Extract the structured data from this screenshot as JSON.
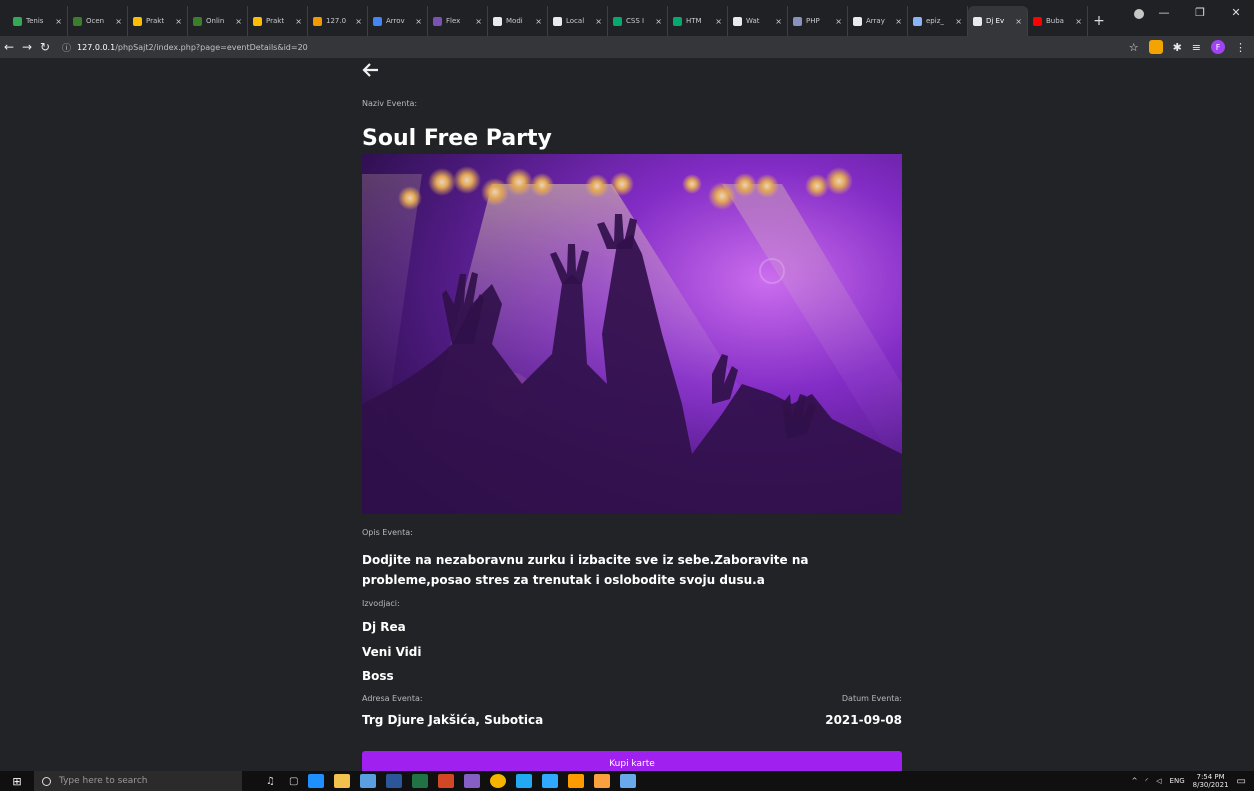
{
  "browser": {
    "tabs": [
      {
        "label": "Tenis",
        "color": "#34a853"
      },
      {
        "label": "Ocen",
        "color": "#3a7d2b"
      },
      {
        "label": "Prakt",
        "color": "#fbbc04"
      },
      {
        "label": "Onlin",
        "color": "#3a7d2b"
      },
      {
        "label": "Prakt",
        "color": "#fbbc04"
      },
      {
        "label": "127.0",
        "color": "#f29900"
      },
      {
        "label": "Arrov",
        "color": "#4285f4"
      },
      {
        "label": "Flex",
        "color": "#7952b3"
      },
      {
        "label": "Modi",
        "color": "#e8eaed"
      },
      {
        "label": "Local",
        "color": "#e8eaed"
      },
      {
        "label": "CSS I",
        "color": "#04aa6d"
      },
      {
        "label": "HTM",
        "color": "#04aa6d"
      },
      {
        "label": "Wat",
        "color": "#e8eaed"
      },
      {
        "label": "PHP",
        "color": "#8892bf"
      },
      {
        "label": "Array",
        "color": "#e8eaed"
      },
      {
        "label": "epiz_",
        "color": "#8ab4f8"
      },
      {
        "label": "Dj Ev",
        "color": "#e8eaed",
        "active": true
      },
      {
        "label": "Buba",
        "color": "#ff0000"
      }
    ],
    "tab_close": "×",
    "new_tab": "+",
    "url_host": "127.0.0.1",
    "url_path": "/phpSajt2/index.php?page=eventDetails&id=20",
    "profile_initial": "F"
  },
  "event": {
    "back_icon": "arrow-left-icon",
    "name_label": "Naziv Eventa:",
    "name": "Soul Free Party",
    "desc_label": "Opis Eventa:",
    "description": "Dodjite na nezaboravnu zurku i izbacite sve iz sebe.Zaboravite na probleme,posao stres za trenutak i oslobodite svoju dusu.a",
    "performers_label": "Izvodjaci:",
    "performers": [
      "Dj Rea",
      "Veni Vidi",
      "Boss"
    ],
    "address_label": "Adresa Eventa:",
    "address": "Trg Djure Jakšića, Subotica",
    "date_label": "Datum Eventa:",
    "date": "2021-09-08",
    "buy_label": "Kupi karte"
  },
  "taskbar": {
    "search_placeholder": "Type here to search",
    "lang": "ENG",
    "time": "7:54 PM",
    "date": "8/30/2021"
  }
}
